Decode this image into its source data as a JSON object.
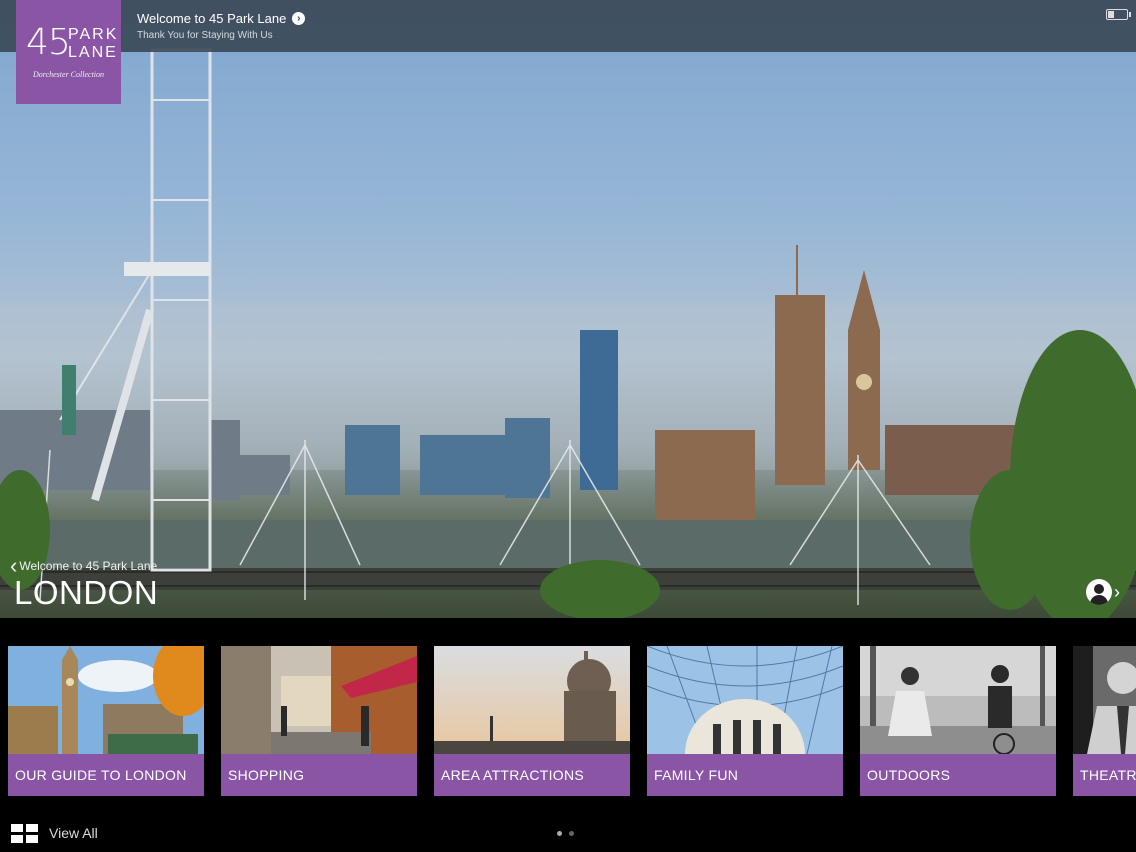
{
  "header": {
    "logo": {
      "number": "45",
      "word_line1": "PARK",
      "word_line2": "LANE",
      "sub": "Dorchester Collection"
    },
    "welcome_title": "Welcome to 45 Park Lane",
    "welcome_subtitle": "Thank You for Staying With Us"
  },
  "hero": {
    "breadcrumb": "Welcome to 45 Park Lane",
    "title": "LONDON"
  },
  "cards": [
    {
      "label": "OUR GUIDE TO LONDON"
    },
    {
      "label": "SHOPPING"
    },
    {
      "label": "AREA ATTRACTIONS"
    },
    {
      "label": "FAMILY FUN"
    },
    {
      "label": "OUTDOORS"
    },
    {
      "label": "THEATRE"
    }
  ],
  "footer": {
    "view_all": "View All",
    "page_count": 2,
    "active_page": 1
  },
  "colors": {
    "brand_purple": "#8a55a5",
    "topbar": "#374452"
  },
  "icons": [
    "arrow-right-circle-icon",
    "battery-icon",
    "chevron-left-icon",
    "user-profile-icon",
    "chevron-right-icon",
    "grid-view-icon"
  ]
}
